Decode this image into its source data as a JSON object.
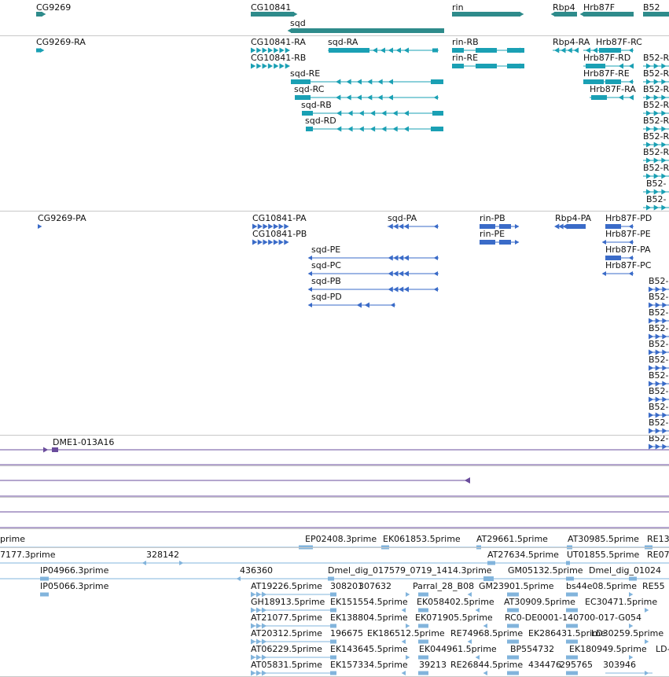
{
  "colors": {
    "gene": "#2e8b8b",
    "mrna": "#1aa0b4",
    "protein": "#3a6bc8",
    "clone": "#6a4c9c",
    "est": "#82b4dc",
    "separator": "#c8c8c8"
  },
  "tracks": {
    "genes": [
      "CG9269",
      "CG10841",
      "sqd",
      "rin",
      "Rbp4",
      "Hrb87F",
      "B52"
    ],
    "transcripts": [
      "CG9269-RA",
      "CG10841-RA",
      "CG10841-RB",
      "sqd-RA",
      "sqd-RE",
      "sqd-RC",
      "sqd-RB",
      "sqd-RD",
      "rin-RB",
      "rin-RE",
      "Rbp4-RA",
      "Hrb87F-RC",
      "Hrb87F-RD",
      "Hrb87F-RE",
      "Hrb87F-RA",
      "B52-R",
      "B52-R",
      "B52-R",
      "B52-R",
      "B52-R",
      "B52-R",
      "B52-R",
      "B52-R",
      "B52-",
      "B52-"
    ],
    "proteins": [
      "CG9269-PA",
      "CG10841-PA",
      "CG10841-PB",
      "sqd-PA",
      "sqd-PE",
      "sqd-PC",
      "sqd-PB",
      "sqd-PD",
      "rin-PB",
      "rin-PE",
      "Rbp4-PA",
      "Hrb87F-PD",
      "Hrb87F-PE",
      "Hrb87F-PA",
      "Hrb87F-PC",
      "B52-",
      "B52-",
      "B52-",
      "B52-",
      "B52-",
      "B52-",
      "B52-",
      "B52-",
      "B52-",
      "B52-",
      "B52-"
    ],
    "clones": [
      "DME1-013A16"
    ],
    "ests": [
      "prime",
      "EP02408.3prime",
      "EK061853.5prime",
      "AT29661.5prime",
      "AT30985.5prime",
      "RE13",
      "7177.3prime",
      "328142",
      "AT27634.5prime",
      "UT01855.5prime",
      "RE07",
      "IP04966.3prime",
      "436360",
      "Dmel_dig_017579_0719_1414.3prime",
      "GM05132.5prime",
      "Dmel_dig_01024",
      "IP05066.3prime",
      "AT19226.5prime",
      "308201",
      "307632",
      "Parral_28_B08",
      "GM23901.5prime",
      "bs44e08.5prime",
      "RE55",
      "GH18913.5prime",
      "EK151554.5prime",
      "EK058402.5prime",
      "AT30909.5prime",
      "EC30471.5prime",
      "AT21077.5prime",
      "EK138804.5prime",
      "EK071905.5prime",
      "RC0-DE0001-140700-017-G054",
      "AT20312.5prime",
      "196675",
      "EK186512.5prime",
      "RE74968.5prime",
      "EK286431.5prime",
      "LD30259.5prime",
      "AT06229.5prime",
      "EK143645.5prime",
      "EK044961.5prime",
      "BP554732",
      "EK180949.5prime",
      "LD-",
      "AT05831.5prime",
      "EK157334.5prime",
      "39213",
      "RE26844.5prime",
      "434476",
      "295765",
      "303946"
    ]
  }
}
